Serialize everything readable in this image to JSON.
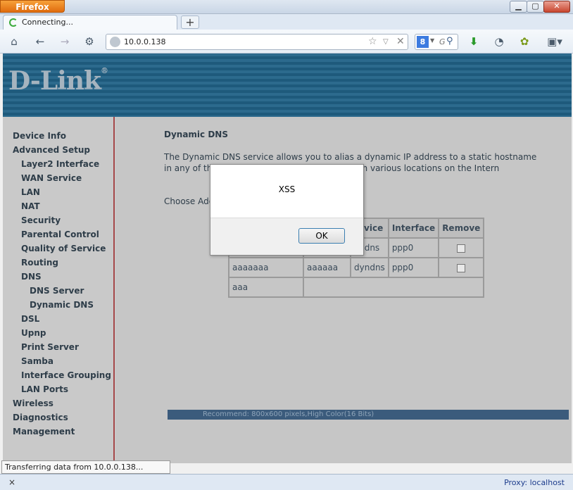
{
  "browser": {
    "app_button": "Firefox",
    "tab_title": "Connecting...",
    "new_tab": "+",
    "url": "10.0.0.138",
    "search_placeholder": "G"
  },
  "header": {
    "logo": "D-Link",
    "logo_mark": "®"
  },
  "sidebar": {
    "items": [
      "Device Info",
      "Advanced Setup",
      "Layer2 Interface",
      "WAN Service",
      "LAN",
      "NAT",
      "Security",
      "Parental Control",
      "Quality of Service",
      "Routing",
      "DNS",
      "DNS Server",
      "Dynamic DNS",
      "DSL",
      "Upnp",
      "Print Server",
      "Samba",
      "Interface Grouping",
      "LAN Ports",
      "Wireless",
      "Diagnostics",
      "Management"
    ]
  },
  "main": {
    "title": "Dynamic DNS",
    "description": "The Dynamic DNS service allows you to alias a dynamic IP address to a static hostname in any of the many d                                        more easily accessed from various locations on the Intern",
    "choose": "Choose Add",
    "table": {
      "headers": [
        "ervice",
        "Interface",
        "Remove"
      ],
      "rows": [
        [
          "",
          "",
          "yndns",
          "ppp0"
        ],
        [
          "aaaaaaa",
          "aaaaaa",
          "dyndns",
          "ppp0"
        ],
        [
          "aaa"
        ]
      ]
    },
    "recommend": "Recommend: 800x600 pixels,High Color(16 Bits)"
  },
  "status": {
    "transfer": "Transferring data from 10.0.0.138...",
    "close": "×",
    "proxy": "Proxy: localhost"
  },
  "alert": {
    "message": "XSS",
    "ok": "OK"
  }
}
